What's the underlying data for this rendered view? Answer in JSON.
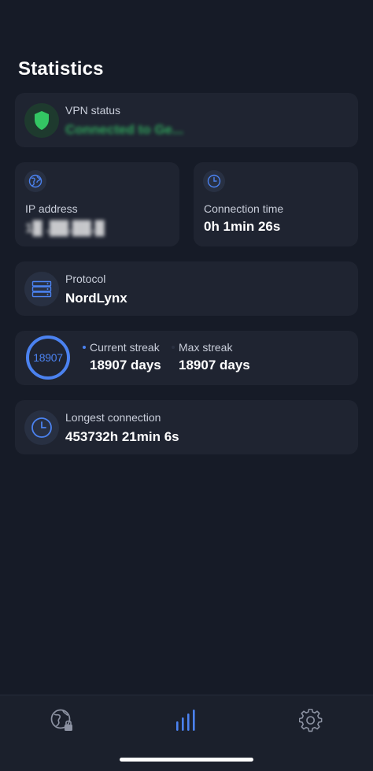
{
  "page": {
    "title": "Statistics"
  },
  "vpn_status": {
    "label": "VPN status",
    "value": "Connected to Ge...",
    "value_color": "#37d26a",
    "icon": "shield-icon"
  },
  "ip_address": {
    "label": "IP address",
    "value": "1█ .██.██.█",
    "icon": "globe-icon"
  },
  "connection_time": {
    "label": "Connection time",
    "value": "0h 1min 26s",
    "icon": "clock-icon"
  },
  "protocol": {
    "label": "Protocol",
    "value": "NordLynx",
    "icon": "server-icon"
  },
  "streak": {
    "ring_value": "18907",
    "current_label": "Current streak",
    "current_value": "18907 days",
    "max_label": "Max streak",
    "max_value": "18907 days",
    "accent": "#4b82f0"
  },
  "longest_connection": {
    "label": "Longest connection",
    "value": "453732h 21min 6s",
    "icon": "clock-icon"
  },
  "tabbar": {
    "items": [
      {
        "name": "vpn",
        "icon": "globe-lock-icon",
        "active": false
      },
      {
        "name": "statistics",
        "icon": "bar-chart-icon",
        "active": true
      },
      {
        "name": "settings",
        "icon": "gear-icon",
        "active": false
      }
    ],
    "active_color": "#4b82f0",
    "inactive_color": "#8d93a3"
  }
}
